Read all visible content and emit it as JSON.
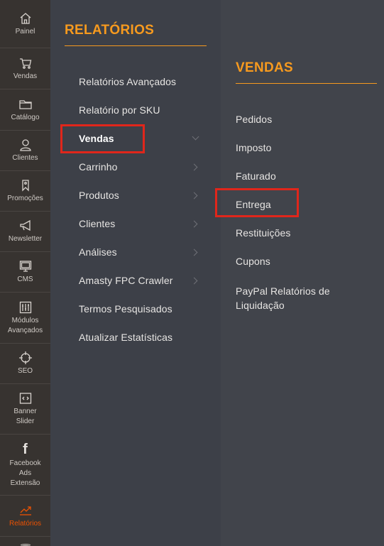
{
  "sidebar": {
    "items": [
      {
        "label": "Painel",
        "icon": "home-icon"
      },
      {
        "label": "Vendas",
        "icon": "cart-icon"
      },
      {
        "label": "Catálogo",
        "icon": "folder-icon"
      },
      {
        "label": "Clientes",
        "icon": "user-icon"
      },
      {
        "label": "Promoções",
        "icon": "tag-icon"
      },
      {
        "label": "Newsletter",
        "icon": "megaphone-icon"
      },
      {
        "label": "CMS",
        "icon": "monitor-icon"
      },
      {
        "label": "Módulos Avançados",
        "icon": "sliders-icon"
      },
      {
        "label": "SEO",
        "icon": "crosshair-icon"
      },
      {
        "label": "Banner Slider",
        "icon": "code-icon"
      },
      {
        "label": "Facebook Ads Extensão",
        "icon": "facebook-icon"
      },
      {
        "label": "Relatórios",
        "icon": "chart-icon"
      }
    ]
  },
  "relatorios": {
    "title": "RELATÓRIOS",
    "items": [
      {
        "label": "Relatórios Avançados"
      },
      {
        "label": "Relatório por SKU"
      },
      {
        "label": "Vendas"
      },
      {
        "label": "Carrinho"
      },
      {
        "label": "Produtos"
      },
      {
        "label": "Clientes"
      },
      {
        "label": "Análises"
      },
      {
        "label": "Amasty FPC Crawler"
      },
      {
        "label": "Termos Pesquisados"
      },
      {
        "label": "Atualizar Estatísticas"
      }
    ]
  },
  "vendas": {
    "title": "VENDAS",
    "items": [
      {
        "label": "Pedidos"
      },
      {
        "label": "Imposto"
      },
      {
        "label": "Faturado"
      },
      {
        "label": "Entrega"
      },
      {
        "label": "Restituições"
      },
      {
        "label": "Cupons"
      },
      {
        "label": "PayPal Relatórios de Liquidação"
      }
    ]
  },
  "colors": {
    "accent": "#f79a1e",
    "active": "#eb5202",
    "highlight": "#e0261b"
  }
}
